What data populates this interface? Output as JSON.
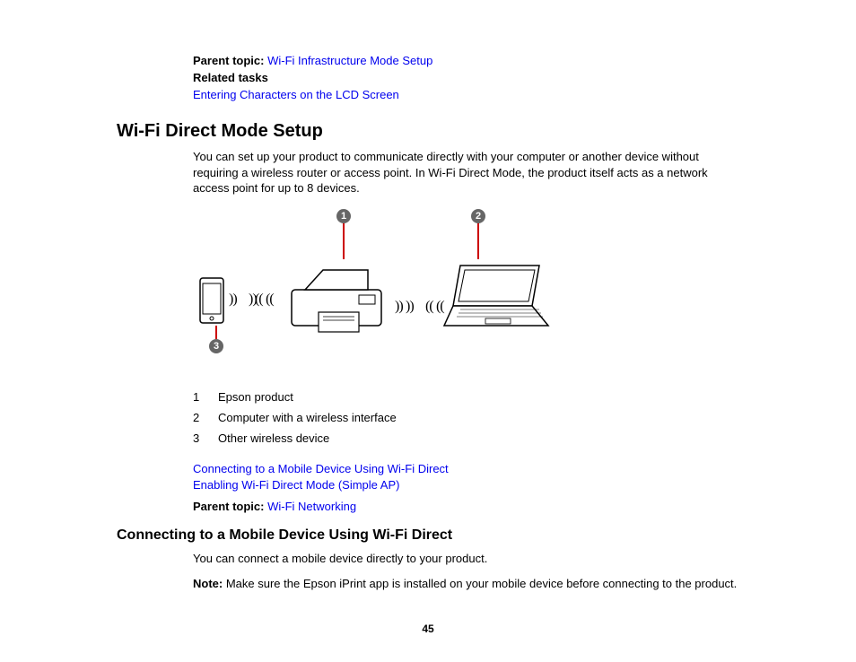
{
  "top": {
    "parentTopicLabel": "Parent topic:",
    "parentTopicLink": "Wi-Fi Infrastructure Mode Setup",
    "relatedTasksLabel": "Related tasks",
    "relatedTaskLink": "Entering Characters on the LCD Screen"
  },
  "section": {
    "title": "Wi-Fi Direct Mode Setup",
    "intro": "You can set up your product to communicate directly with your computer or another device without requiring a wireless router or access point. In Wi-Fi Direct Mode, the product itself acts as a network access point for up to 8 devices."
  },
  "callouts": {
    "c1": "1",
    "c2": "2",
    "c3": "3"
  },
  "legend": [
    {
      "num": "1",
      "text": "Epson product"
    },
    {
      "num": "2",
      "text": "Computer with a wireless interface"
    },
    {
      "num": "3",
      "text": "Other wireless device"
    }
  ],
  "links": {
    "l1": "Connecting to a Mobile Device Using Wi-Fi Direct",
    "l2": "Enabling Wi-Fi Direct Mode (Simple AP)"
  },
  "parent2": {
    "label": "Parent topic:",
    "link": "Wi-Fi Networking"
  },
  "subsection": {
    "title": "Connecting to a Mobile Device Using Wi-Fi Direct",
    "intro": "You can connect a mobile device directly to your product.",
    "noteLabel": "Note:",
    "noteText": " Make sure the Epson iPrint app is installed on your mobile device before connecting to the product."
  },
  "pageNumber": "45"
}
